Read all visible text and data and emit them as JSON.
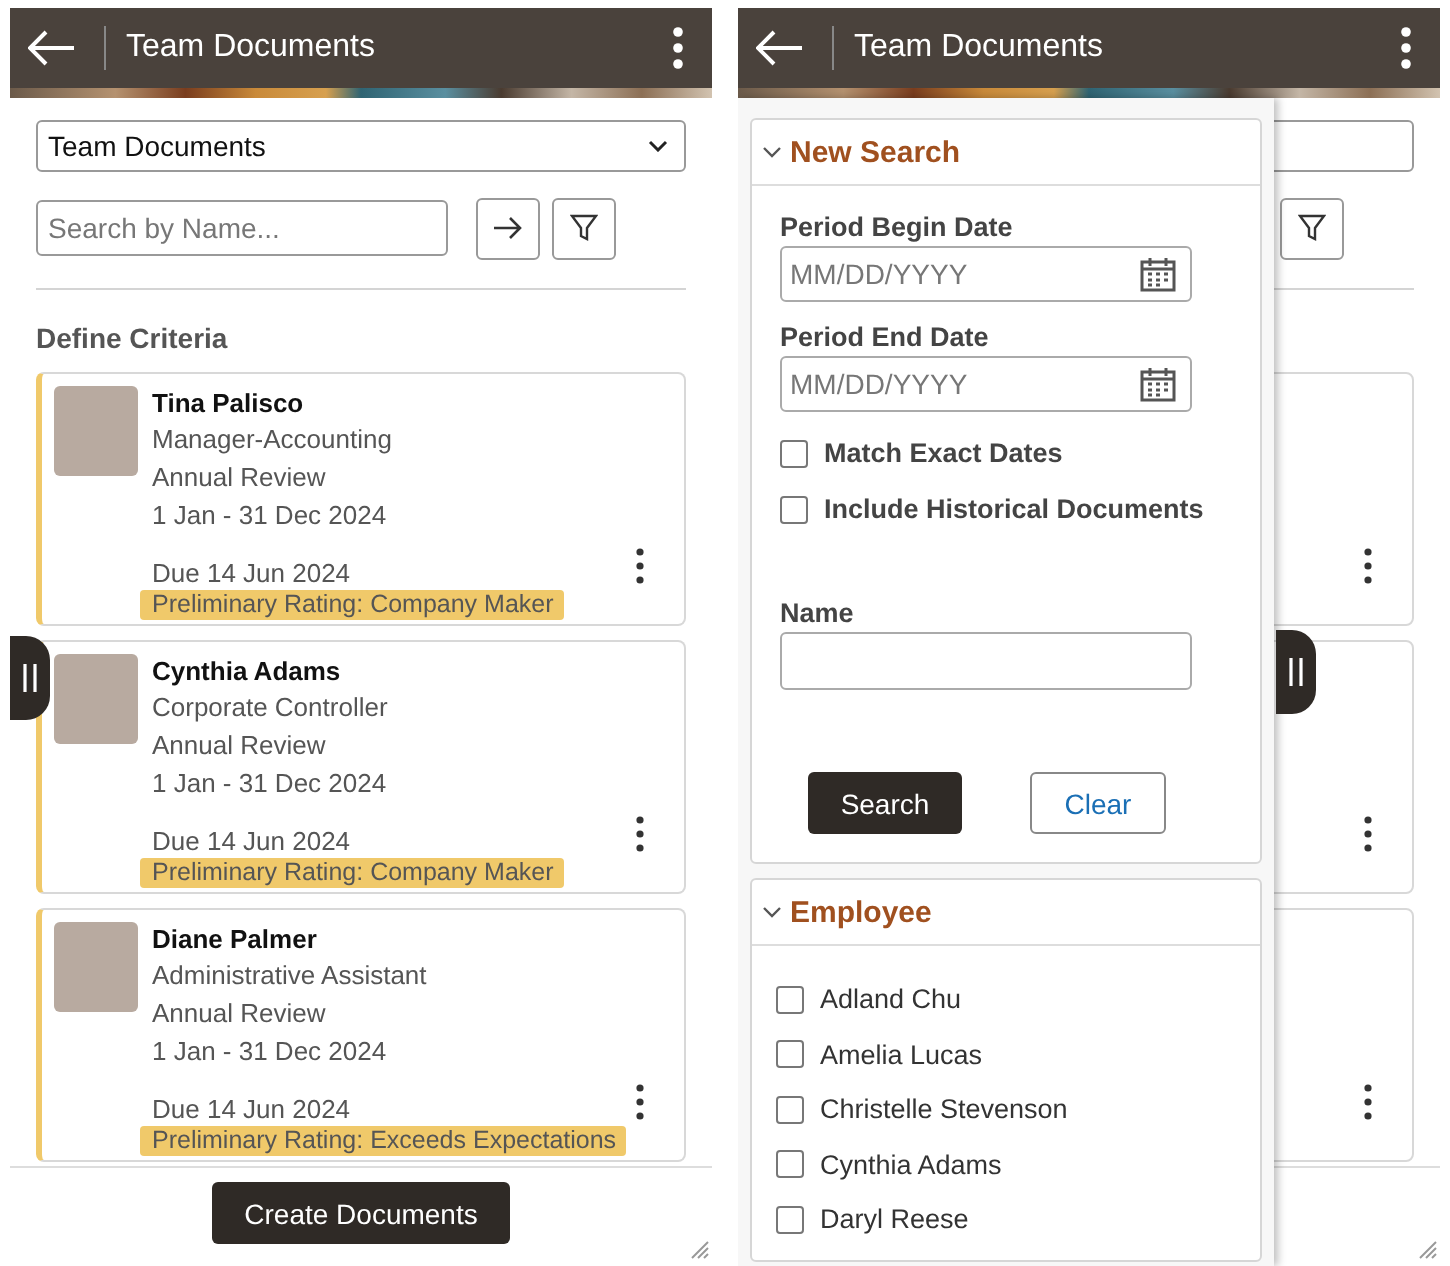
{
  "list_screen": {
    "header": {
      "title": "Team Documents"
    },
    "view_select": {
      "value": "Team Documents"
    },
    "search": {
      "placeholder": "Search by Name..."
    },
    "section_title": "Define Criteria",
    "documents": [
      {
        "name": "Tina Palisco",
        "job": "Manager-Accounting",
        "type": "Annual Review",
        "period": "1 Jan - 31 Dec 2024",
        "due": "Due 14 Jun 2024",
        "rating": "Preliminary Rating: Company Maker"
      },
      {
        "name": "Cynthia Adams",
        "job": "Corporate Controller",
        "type": "Annual Review",
        "period": "1 Jan - 31 Dec 2024",
        "due": "Due 14 Jun 2024",
        "rating": "Preliminary Rating: Company Maker"
      },
      {
        "name": "Diane Palmer",
        "job": "Administrative Assistant",
        "type": "Annual Review",
        "period": "1 Jan - 31 Dec 2024",
        "due": "Due 14 Jun 2024",
        "rating": "Preliminary Rating: Exceeds Expectations"
      }
    ],
    "footer_button": "Create Documents"
  },
  "filter_screen": {
    "header": {
      "title": "Team Documents"
    },
    "new_search": {
      "title": "New Search",
      "expanded": true,
      "date_fields": [
        {
          "label": "Period Begin Date",
          "placeholder": "MM/DD/YYYY"
        },
        {
          "label": "Period End Date",
          "placeholder": "MM/DD/YYYY"
        }
      ],
      "options": [
        {
          "label": "Match Exact Dates",
          "checked": false
        },
        {
          "label": "Include Historical Documents",
          "checked": false
        }
      ],
      "name_field": {
        "label": "Name"
      },
      "buttons": [
        {
          "label": "Search",
          "kind": "primary"
        },
        {
          "label": "Clear",
          "kind": "secondary"
        }
      ]
    },
    "employee": {
      "title": "Employee",
      "expanded": true,
      "options": [
        {
          "label": "Adland Chu",
          "checked": false
        },
        {
          "label": "Amelia Lucas",
          "checked": false
        },
        {
          "label": "Christelle Stevenson",
          "checked": false
        },
        {
          "label": "Cynthia Adams",
          "checked": false
        },
        {
          "label": "Daryl Reese",
          "checked": false
        }
      ]
    }
  }
}
